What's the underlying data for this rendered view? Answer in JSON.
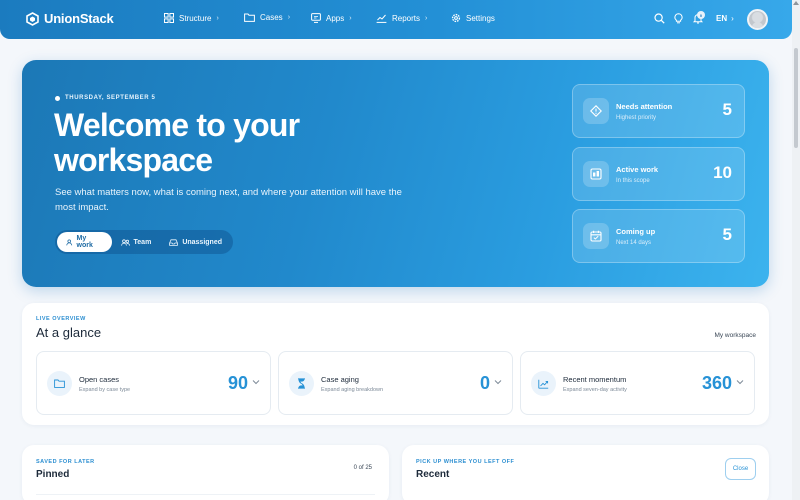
{
  "nav": {
    "brand": "UnionStack",
    "items": [
      {
        "label": "Structure",
        "icon": "grid-icon"
      },
      {
        "label": "Cases",
        "icon": "folder-icon"
      },
      {
        "label": "Apps",
        "icon": "apps-icon"
      },
      {
        "label": "Reports",
        "icon": "reports-icon"
      },
      {
        "label": "Settings",
        "icon": "gear-icon"
      }
    ],
    "chevron": "›",
    "notification_badge": "0",
    "language": "EN",
    "language_chevron": "›"
  },
  "hero": {
    "date": "THURSDAY, SEPTEMBER 5",
    "title": "Welcome to your workspace",
    "subtitle": "See what matters now, what is coming next, and where your attention will have the most impact.",
    "tabs": [
      {
        "label": "My work",
        "active": true
      },
      {
        "label": "Team",
        "active": false
      },
      {
        "label": "Unassigned",
        "active": false
      }
    ],
    "stats": [
      {
        "title": "Needs attention",
        "sub": "Highest priority",
        "value": "5",
        "icon": "alert-diamond-icon"
      },
      {
        "title": "Active work",
        "sub": "In this scope",
        "value": "10",
        "icon": "board-icon"
      },
      {
        "title": "Coming up",
        "sub": "Next 14 days",
        "value": "5",
        "icon": "calendar-icon"
      }
    ]
  },
  "overview": {
    "eyebrow": "LIVE OVERVIEW",
    "title": "At a glance",
    "scope": "My workspace",
    "cards": [
      {
        "title": "Open cases",
        "sub": "Expand by case type",
        "value": "90",
        "icon": "folder-icon"
      },
      {
        "title": "Case aging",
        "sub": "Expand aging breakdown",
        "value": "0",
        "icon": "hourglass-icon"
      },
      {
        "title": "Recent momentum",
        "sub": "Expand seven-day activity",
        "value": "360",
        "icon": "trend-icon"
      }
    ]
  },
  "pinned": {
    "eyebrow": "SAVED FOR LATER",
    "title": "Pinned",
    "count": "0 of 25"
  },
  "recent": {
    "eyebrow": "PICK UP WHERE YOU LEFT OFF",
    "title": "Recent",
    "close_label": "Close"
  },
  "colors": {
    "accent": "#2792d6",
    "nav_start": "#1b7bbf",
    "hero_end": "#3cb3ee"
  }
}
